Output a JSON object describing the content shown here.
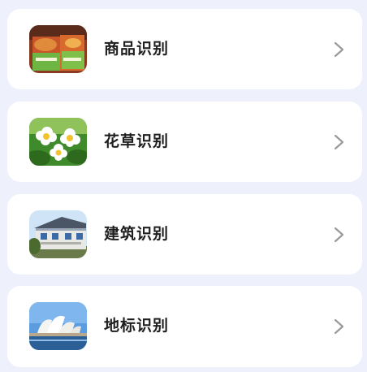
{
  "items": [
    {
      "label": "商品识别",
      "icon": "product-photo",
      "chevron": "chevron-right-icon"
    },
    {
      "label": "花草识别",
      "icon": "flower-photo",
      "chevron": "chevron-right-icon"
    },
    {
      "label": "建筑识别",
      "icon": "building-photo",
      "chevron": "chevron-right-icon"
    },
    {
      "label": "地标识别",
      "icon": "landmark-photo",
      "chevron": "chevron-right-icon"
    }
  ],
  "colors": {
    "background": "#eef1fb",
    "card": "#ffffff",
    "text": "#1f1f1f",
    "chevron": "#9a9a9a"
  }
}
